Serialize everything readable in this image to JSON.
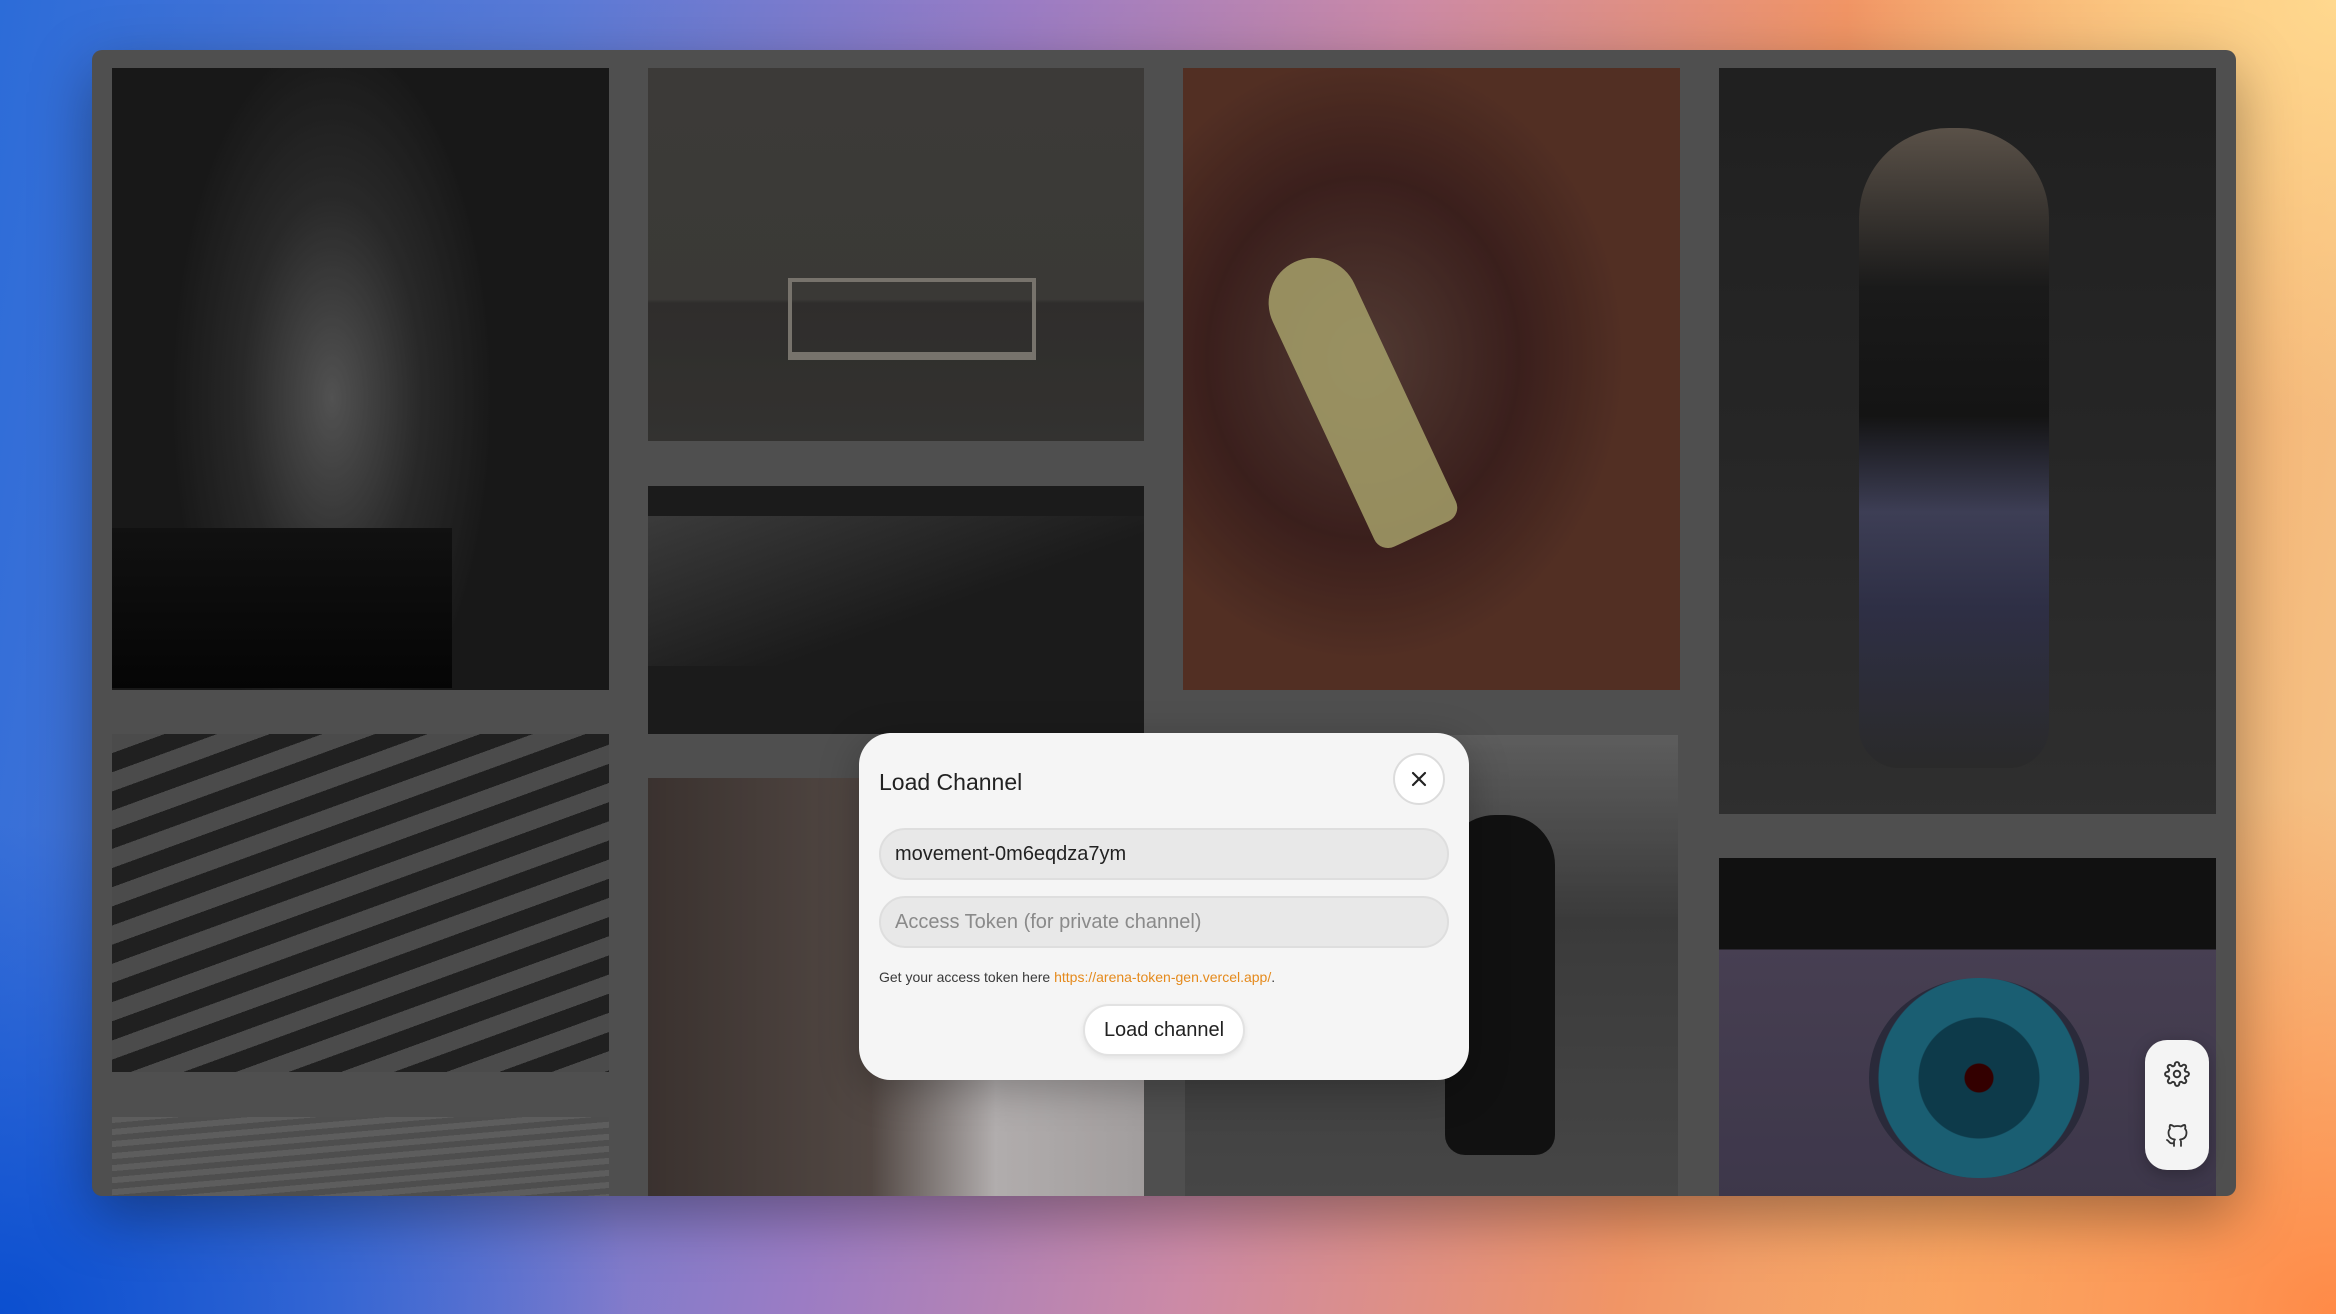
{
  "modal": {
    "title": "Load Channel",
    "channel_input_value": "movement-0m6eqdza7ym",
    "token_input_placeholder": "Access Token (for private channel)",
    "hint_prefix": "Get your access token here ",
    "hint_link": "https://arena-token-gen.vercel.app/",
    "hint_suffix": ".",
    "load_button_label": "Load channel"
  },
  "toolbar": {
    "settings_icon": "gear-icon",
    "github_icon": "github-icon"
  },
  "colors": {
    "link": "#e58a1c",
    "modal_bg": "#f5f5f5"
  }
}
